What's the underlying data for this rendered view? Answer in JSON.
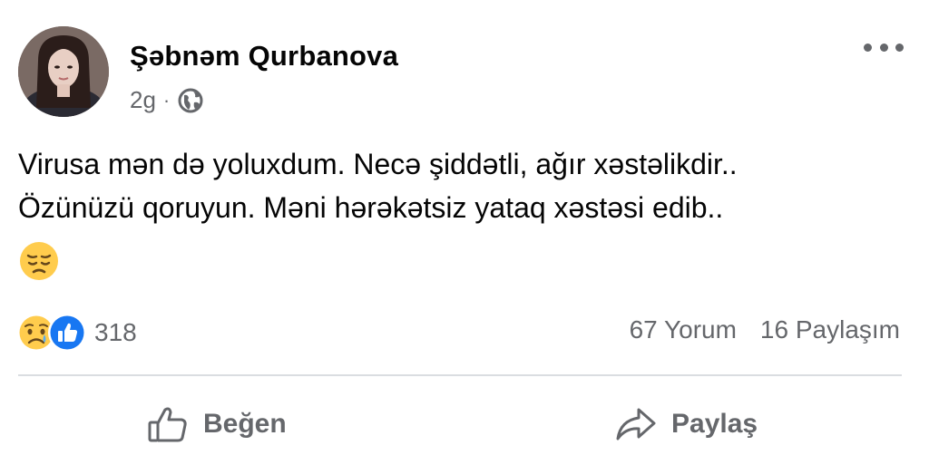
{
  "post": {
    "author": {
      "name": "Şəbnəm Qurbanova",
      "avatar_icon": "profile-photo"
    },
    "time": "2g",
    "separator": "·",
    "privacy_icon": "globe-icon",
    "more_icon": "more-horizontal-icon",
    "text_lines": [
      "Virusa mən də yoluxdum. Necə şiddətli, ağır xəstəlikdir..",
      "Özünüzü qoruyun. Məni hərəkətsiz yataq xəstəsi  edib.."
    ],
    "emoji": "pensive-face"
  },
  "reactions": {
    "icons": [
      "sad-reaction-icon",
      "like-reaction-icon"
    ],
    "count": "318",
    "comments": "67 Yorum",
    "shares": "16 Paylaşım"
  },
  "actions": {
    "like_label": "Beğen",
    "share_label": "Paylaş"
  },
  "colors": {
    "text": "#050505",
    "secondary": "#65676b",
    "like_blue": "#1877f2",
    "emoji_yellow": "#ffcc4d",
    "divider": "#dadde1"
  }
}
